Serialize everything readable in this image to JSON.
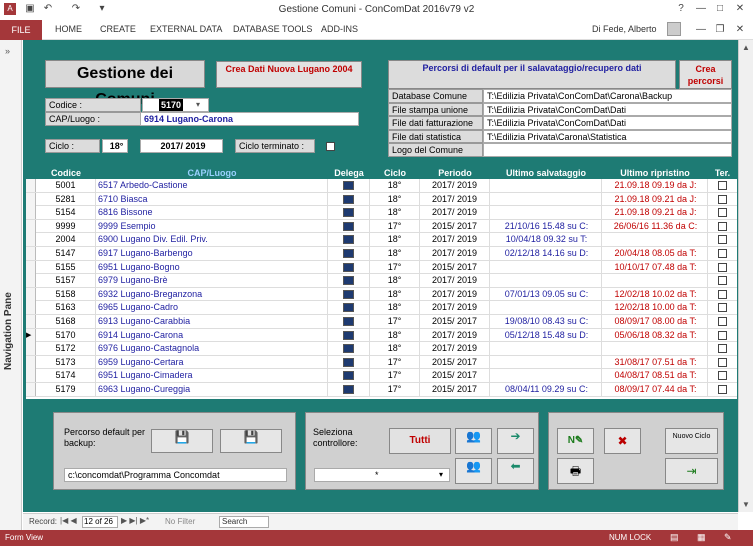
{
  "window": {
    "title": "Gestione Comuni - ConComDat 2016v79 v2",
    "user": "Di Fede, Alberto"
  },
  "ribbon": {
    "file": "FILE",
    "tabs": [
      "HOME",
      "CREATE",
      "EXTERNAL DATA",
      "DATABASE TOOLS",
      "ADD-INS"
    ]
  },
  "nav": {
    "label": "Navigation Pane"
  },
  "form": {
    "title": "Gestione dei Comuni",
    "create_button": "Crea Dati Nuova Lugano 2004",
    "codice_label": "Codice :",
    "codice_value": "5170",
    "cap_label": "CAP/Luogo :",
    "cap_value": "6914 Lugano-Carona",
    "ciclo_label": "Ciclo :",
    "ciclo_value": "18°",
    "periodo_value": "2017/ 2019",
    "terminato_label": "Ciclo terminato :",
    "paths_header": "Percorsi di default per il salavataggio/recupero dati",
    "crea_percorsi": "Crea percorsi",
    "paths": [
      {
        "label": "Database Comune",
        "value": "T:\\Edilizia Privata\\ConComDat\\Carona\\Backup"
      },
      {
        "label": "File stampa unione",
        "value": "T:\\Edilizia Privata\\ConComDat\\Dati"
      },
      {
        "label": "File dati fatturazione",
        "value": "T:\\Edilizia Privata\\ConComDat\\Dati"
      },
      {
        "label": "File dati statistica",
        "value": "T:\\Edilizia Privata\\Carona\\Statistica"
      },
      {
        "label": "Logo del Comune",
        "value": ""
      }
    ]
  },
  "table": {
    "headers": [
      "Codice",
      "CAP/Luogo",
      "Delega",
      "Ciclo",
      "Periodo",
      "Ultimo salvataggio",
      "Ultimo ripristino",
      "Ter."
    ],
    "rows": [
      [
        "5001",
        "6517 Arbedo-Castione",
        "18°",
        "2017/ 2019",
        "",
        "21.09.18 09.19 da J:"
      ],
      [
        "5281",
        "6710 Biasca",
        "18°",
        "2017/ 2019",
        "",
        "21.09.18 09.21 da J:"
      ],
      [
        "5154",
        "6816 Bissone",
        "18°",
        "2017/ 2019",
        "",
        "21.09.18 09.21 da J:"
      ],
      [
        "9999",
        "9999 Esempio",
        "17°",
        "2015/ 2017",
        "21/10/16 15.48 su C:",
        "26/06/16 11.36 da C:"
      ],
      [
        "2004",
        "6900 Lugano Div. Edil. Priv.",
        "18°",
        "2017/ 2019",
        "10/04/18 09.32 su T:",
        ""
      ],
      [
        "5147",
        "6917 Lugano-Barbengo",
        "18°",
        "2017/ 2019",
        "02/12/18 14.16 su D:",
        "20/04/18 08.05 da T:"
      ],
      [
        "5155",
        "6951 Lugano-Bogno",
        "17°",
        "2015/ 2017",
        "",
        "10/10/17 07.48 da T:"
      ],
      [
        "5157",
        "6979 Lugano-Brè",
        "18°",
        "2017/ 2019",
        "",
        ""
      ],
      [
        "5158",
        "6932 Lugano-Breganzona",
        "18°",
        "2017/ 2019",
        "07/01/13 09.05 su C:",
        "12/02/18 10.02 da T:"
      ],
      [
        "5163",
        "6965 Lugano-Cadro",
        "18°",
        "2017/ 2019",
        "",
        "12/02/18 10.00 da T:"
      ],
      [
        "5168",
        "6913 Lugano-Carabbia",
        "17°",
        "2015/ 2017",
        "19/08/10 08.43 su C:",
        "08/09/17 08.00 da T:"
      ],
      [
        "5170",
        "6914 Lugano-Carona",
        "18°",
        "2017/ 2019",
        "05/12/18 15.48 su D:",
        "05/06/18 08.32 da T:"
      ],
      [
        "5172",
        "6976 Lugano-Castagnola",
        "18°",
        "2017/ 2019",
        "",
        ""
      ],
      [
        "5173",
        "6959 Lugano-Certara",
        "17°",
        "2015/ 2017",
        "",
        "31/08/17 07.51 da T:"
      ],
      [
        "5174",
        "6951 Lugano-Cimadera",
        "17°",
        "2015/ 2017",
        "",
        "04/08/17 08.51 da T:"
      ],
      [
        "5179",
        "6963 Lugano-Cureggia",
        "17°",
        "2015/ 2017",
        "08/04/11 09.29 su C:",
        "08/09/17 07.44 da T:"
      ]
    ]
  },
  "bottom": {
    "backup_label": "Percorso default per backup:",
    "backup_path": "c:\\concomdat\\Programma Concomdat",
    "controller_label": "Seleziona controllore:",
    "tutti": "Tutti",
    "asterisk": "*",
    "nuovo_ciclo": "Nuovo Ciclo"
  },
  "recnav": {
    "label": "Record:",
    "position": "12 of 26",
    "nofilter": "No Filter",
    "search": "Search"
  },
  "status": {
    "left": "Form View",
    "numlock": "NUM LOCK"
  }
}
